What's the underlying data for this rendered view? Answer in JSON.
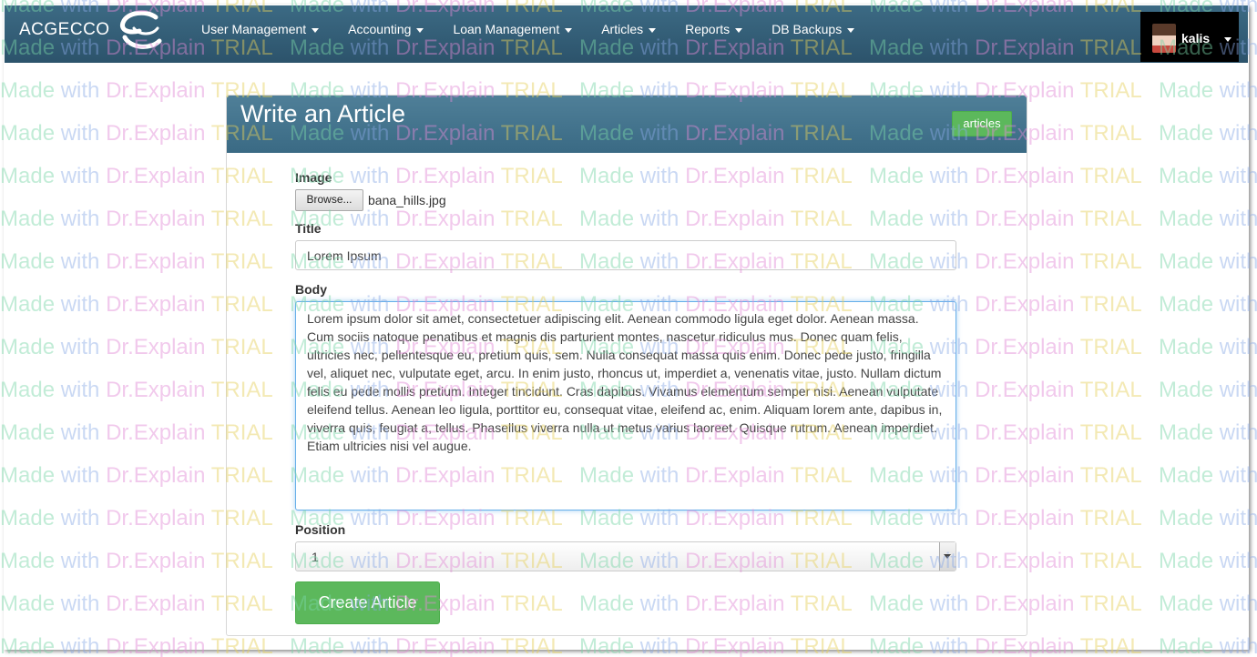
{
  "navbar": {
    "brand": "ACGECCO",
    "items": [
      {
        "label": "User Management"
      },
      {
        "label": "Accounting"
      },
      {
        "label": "Loan Management"
      },
      {
        "label": "Articles"
      },
      {
        "label": "Reports"
      },
      {
        "label": "DB Backups"
      }
    ],
    "user": {
      "name": "kalis"
    }
  },
  "panel": {
    "title": "Write an Article",
    "articles_button": "articles"
  },
  "form": {
    "image_label": "Image",
    "browse_label": "Browse...",
    "file_name": "bana_hills.jpg",
    "title_label": "Title",
    "title_value": "Lorem Ipsum",
    "body_label": "Body",
    "body_value": "Lorem ipsum dolor sit amet, consectetuer adipiscing elit. Aenean commodo ligula eget dolor. Aenean massa. Cum sociis natoque penatibus et magnis dis parturient montes, nascetur ridiculus mus. Donec quam felis, ultricies nec, pellentesque eu, pretium quis, sem. Nulla consequat massa quis enim. Donec pede justo, fringilla vel, aliquet nec, vulputate eget, arcu. In enim justo, rhoncus ut, imperdiet a, venenatis vitae, justo. Nullam dictum felis eu pede mollis pretium. Integer tincidunt. Cras dapibus. Vivamus elementum semper nisi. Aenean vulputate eleifend tellus. Aenean leo ligula, porttitor eu, consequat vitae, eleifend ac, enim. Aliquam lorem ante, dapibus in, viverra quis, feugiat a, tellus. Phasellus viverra nulla ut metus varius laoreet. Quisque rutrum. Aenean imperdiet. Etiam ultricies nisi vel augue.",
    "position_label": "Position",
    "position_value": "1",
    "submit_label": "Create Article"
  },
  "watermark": {
    "part1": "Made",
    "part2": "with",
    "part3": "Dr.Explain",
    "part4": "TRIAL"
  }
}
